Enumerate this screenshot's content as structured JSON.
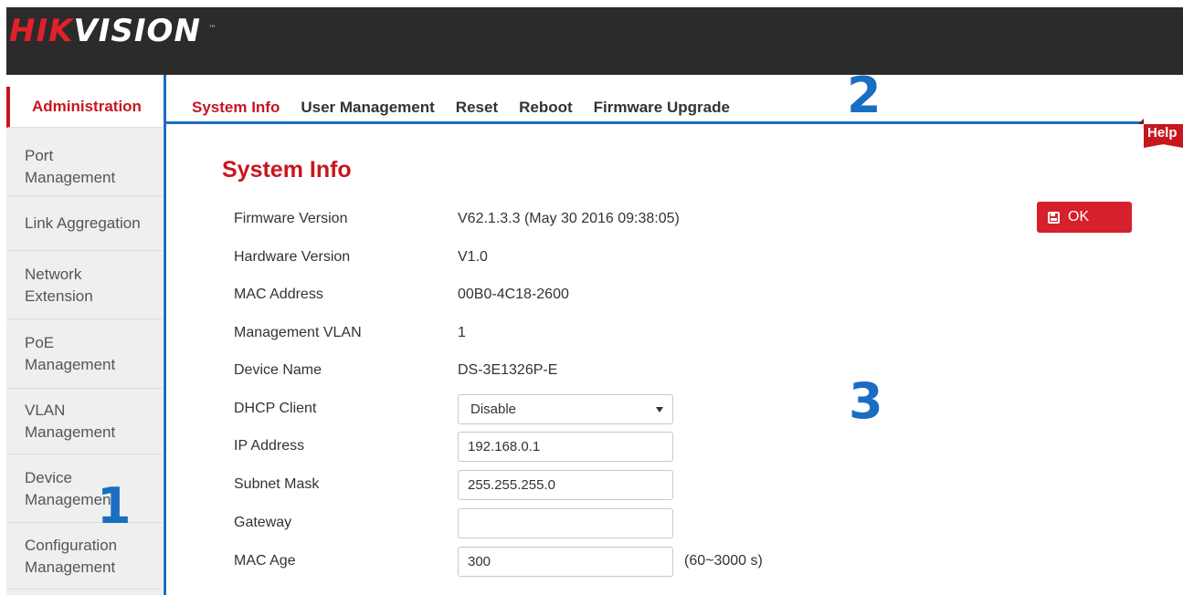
{
  "brand": {
    "logo_part1": "HIK",
    "logo_part2": "VISION",
    "trademark": "™"
  },
  "sidebar": {
    "items": [
      {
        "label": "Administration",
        "active": true
      },
      {
        "label": "Port Management"
      },
      {
        "label": "Link Aggregation"
      },
      {
        "label": "Network Extension"
      },
      {
        "label": "PoE Management"
      },
      {
        "label": "VLAN Management"
      },
      {
        "label": "Device Management"
      },
      {
        "label": "Configuration Management"
      }
    ]
  },
  "tabs": [
    {
      "label": "System Info",
      "active": true
    },
    {
      "label": "User Management"
    },
    {
      "label": "Reset"
    },
    {
      "label": "Reboot"
    },
    {
      "label": "Firmware Upgrade"
    }
  ],
  "help_label": "Help",
  "annotations": {
    "one": "1",
    "two": "2",
    "three": "3"
  },
  "content": {
    "title": "System Info",
    "ok_label": "OK",
    "rows": {
      "firmware": {
        "label": "Firmware Version",
        "value": "V62.1.3.3 (May 30 2016 09:38:05)"
      },
      "hardware": {
        "label": "Hardware Version",
        "value": "V1.0"
      },
      "mac": {
        "label": "MAC Address",
        "value": "00B0-4C18-2600"
      },
      "vlan": {
        "label": "Management VLAN",
        "value": "1"
      },
      "device_name": {
        "label": "Device Name",
        "value": "DS-3E1326P-E"
      },
      "dhcp": {
        "label": "DHCP Client",
        "value": "Disable"
      },
      "ip": {
        "label": "IP Address",
        "value": "192.168.0.1"
      },
      "mask": {
        "label": "Subnet Mask",
        "value": "255.255.255.0"
      },
      "gateway": {
        "label": "Gateway",
        "value": ""
      },
      "mac_age": {
        "label": "MAC Age",
        "value": "300",
        "hint": "(60~3000 s)"
      }
    }
  },
  "colors": {
    "accent_red": "#c8161d",
    "annotation_blue": "#1a6ec1",
    "header_dark": "#2b2b2b"
  }
}
